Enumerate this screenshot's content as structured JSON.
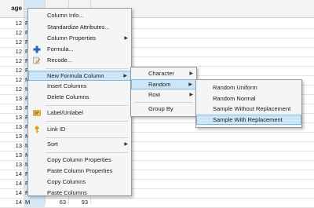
{
  "table": {
    "header": "age",
    "rows": [
      {
        "age": "12",
        "sex": "F"
      },
      {
        "age": "12",
        "sex": "F"
      },
      {
        "age": "12",
        "sex": "F"
      },
      {
        "age": "12",
        "sex": "F"
      },
      {
        "age": "12",
        "sex": "F"
      },
      {
        "age": "12",
        "sex": "F"
      },
      {
        "age": "12",
        "sex": "M"
      },
      {
        "age": "12",
        "sex": "M"
      },
      {
        "age": "13",
        "sex": "F"
      },
      {
        "age": "13",
        "sex": "F"
      },
      {
        "age": "13",
        "sex": "F"
      },
      {
        "age": "13",
        "sex": "F"
      },
      {
        "age": "13",
        "sex": "M"
      },
      {
        "age": "13",
        "sex": "M"
      },
      {
        "age": "13",
        "sex": "M"
      },
      {
        "age": "13",
        "sex": "M"
      },
      {
        "age": "14",
        "sex": "F"
      },
      {
        "age": "14",
        "sex": "F"
      },
      {
        "age": "14",
        "sex": "F"
      },
      {
        "age": "14",
        "sex": "M",
        "v1": "63",
        "v2": "93"
      }
    ]
  },
  "context_menu": {
    "items": [
      "Column Info...",
      "Standardize Attributes...",
      "Column Properties",
      "Formula...",
      "Recode...",
      "New Formula Column",
      "Insert Columns",
      "Delete Columns",
      "Label/Unlabel",
      "Link ID",
      "Sort",
      "Copy Column Properties",
      "Paste Column Properties",
      "Copy Columns",
      "Paste Columns"
    ]
  },
  "submenu1": {
    "items": [
      "Character",
      "Random",
      "Row",
      "Group By"
    ]
  },
  "submenu2": {
    "items": [
      "Random Uniform",
      "Random Normal",
      "Sample Without Replacement",
      "Sample With Replacement"
    ]
  },
  "icons": {
    "formula": "formula-plus-icon",
    "recode": "recode-pencil-icon",
    "label": "label-tag-icon",
    "link": "key-icon"
  }
}
